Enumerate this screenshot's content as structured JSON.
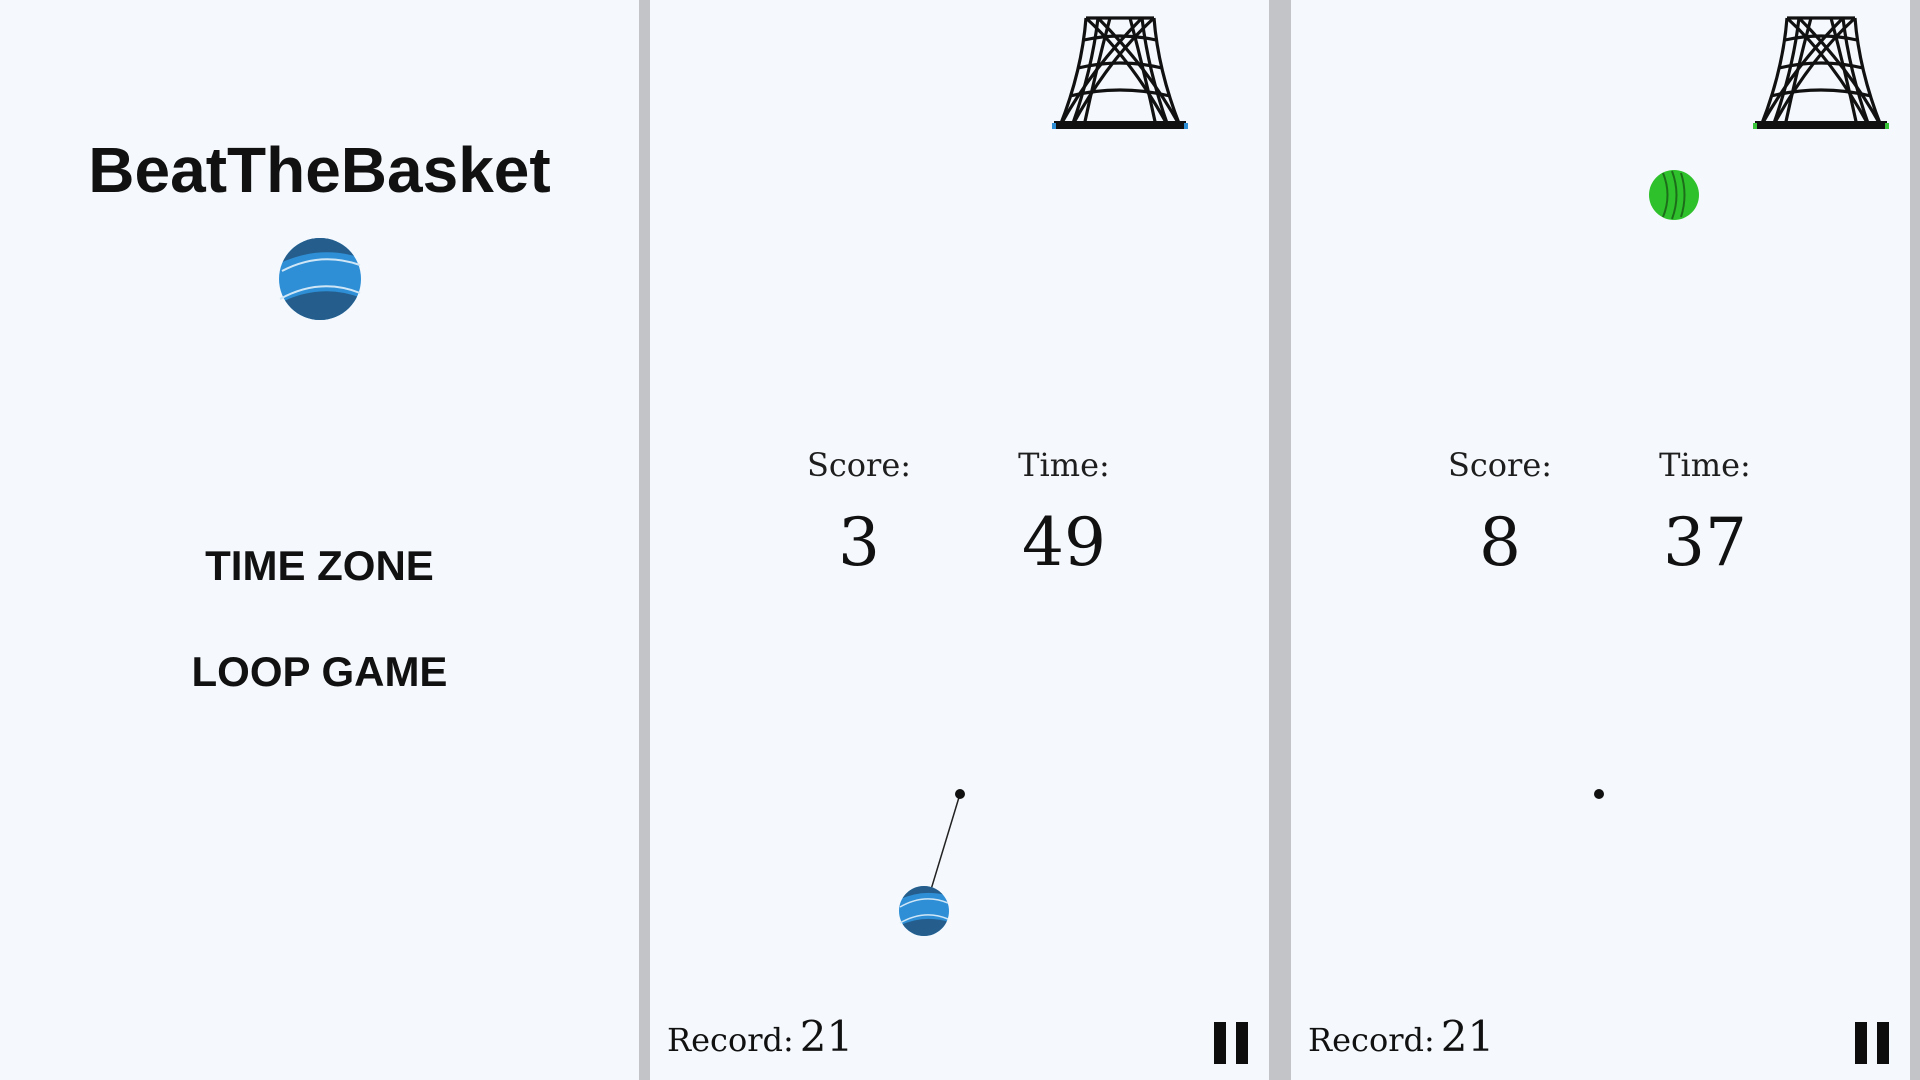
{
  "menu": {
    "title": "BeatTheBasket",
    "options": [
      "TIME ZONE",
      "LOOP GAME"
    ]
  },
  "games": [
    {
      "score_label": "Score:",
      "score": "3",
      "time_label": "Time:",
      "time": "49",
      "record_label": "Record:",
      "record": "21",
      "ball_color": "#2e8fd6",
      "rim_color": "#2f8fd6"
    },
    {
      "score_label": "Score:",
      "score": "8",
      "time_label": "Time:",
      "time": "37",
      "record_label": "Record:",
      "record": "21",
      "ball_color": "#2fc12c",
      "rim_color": "#39c53a"
    }
  ],
  "icons": {
    "logo": "blue-ball-icon",
    "basket": "basket-net-icon",
    "pause": "pause-icon"
  },
  "colors": {
    "background": "#f5f9fd",
    "divider": "#c6c7ca",
    "text": "#111111",
    "blue_ball": "#2e8fd6",
    "blue_ball_dark": "#255e8c",
    "green_ball": "#2fc12c"
  }
}
